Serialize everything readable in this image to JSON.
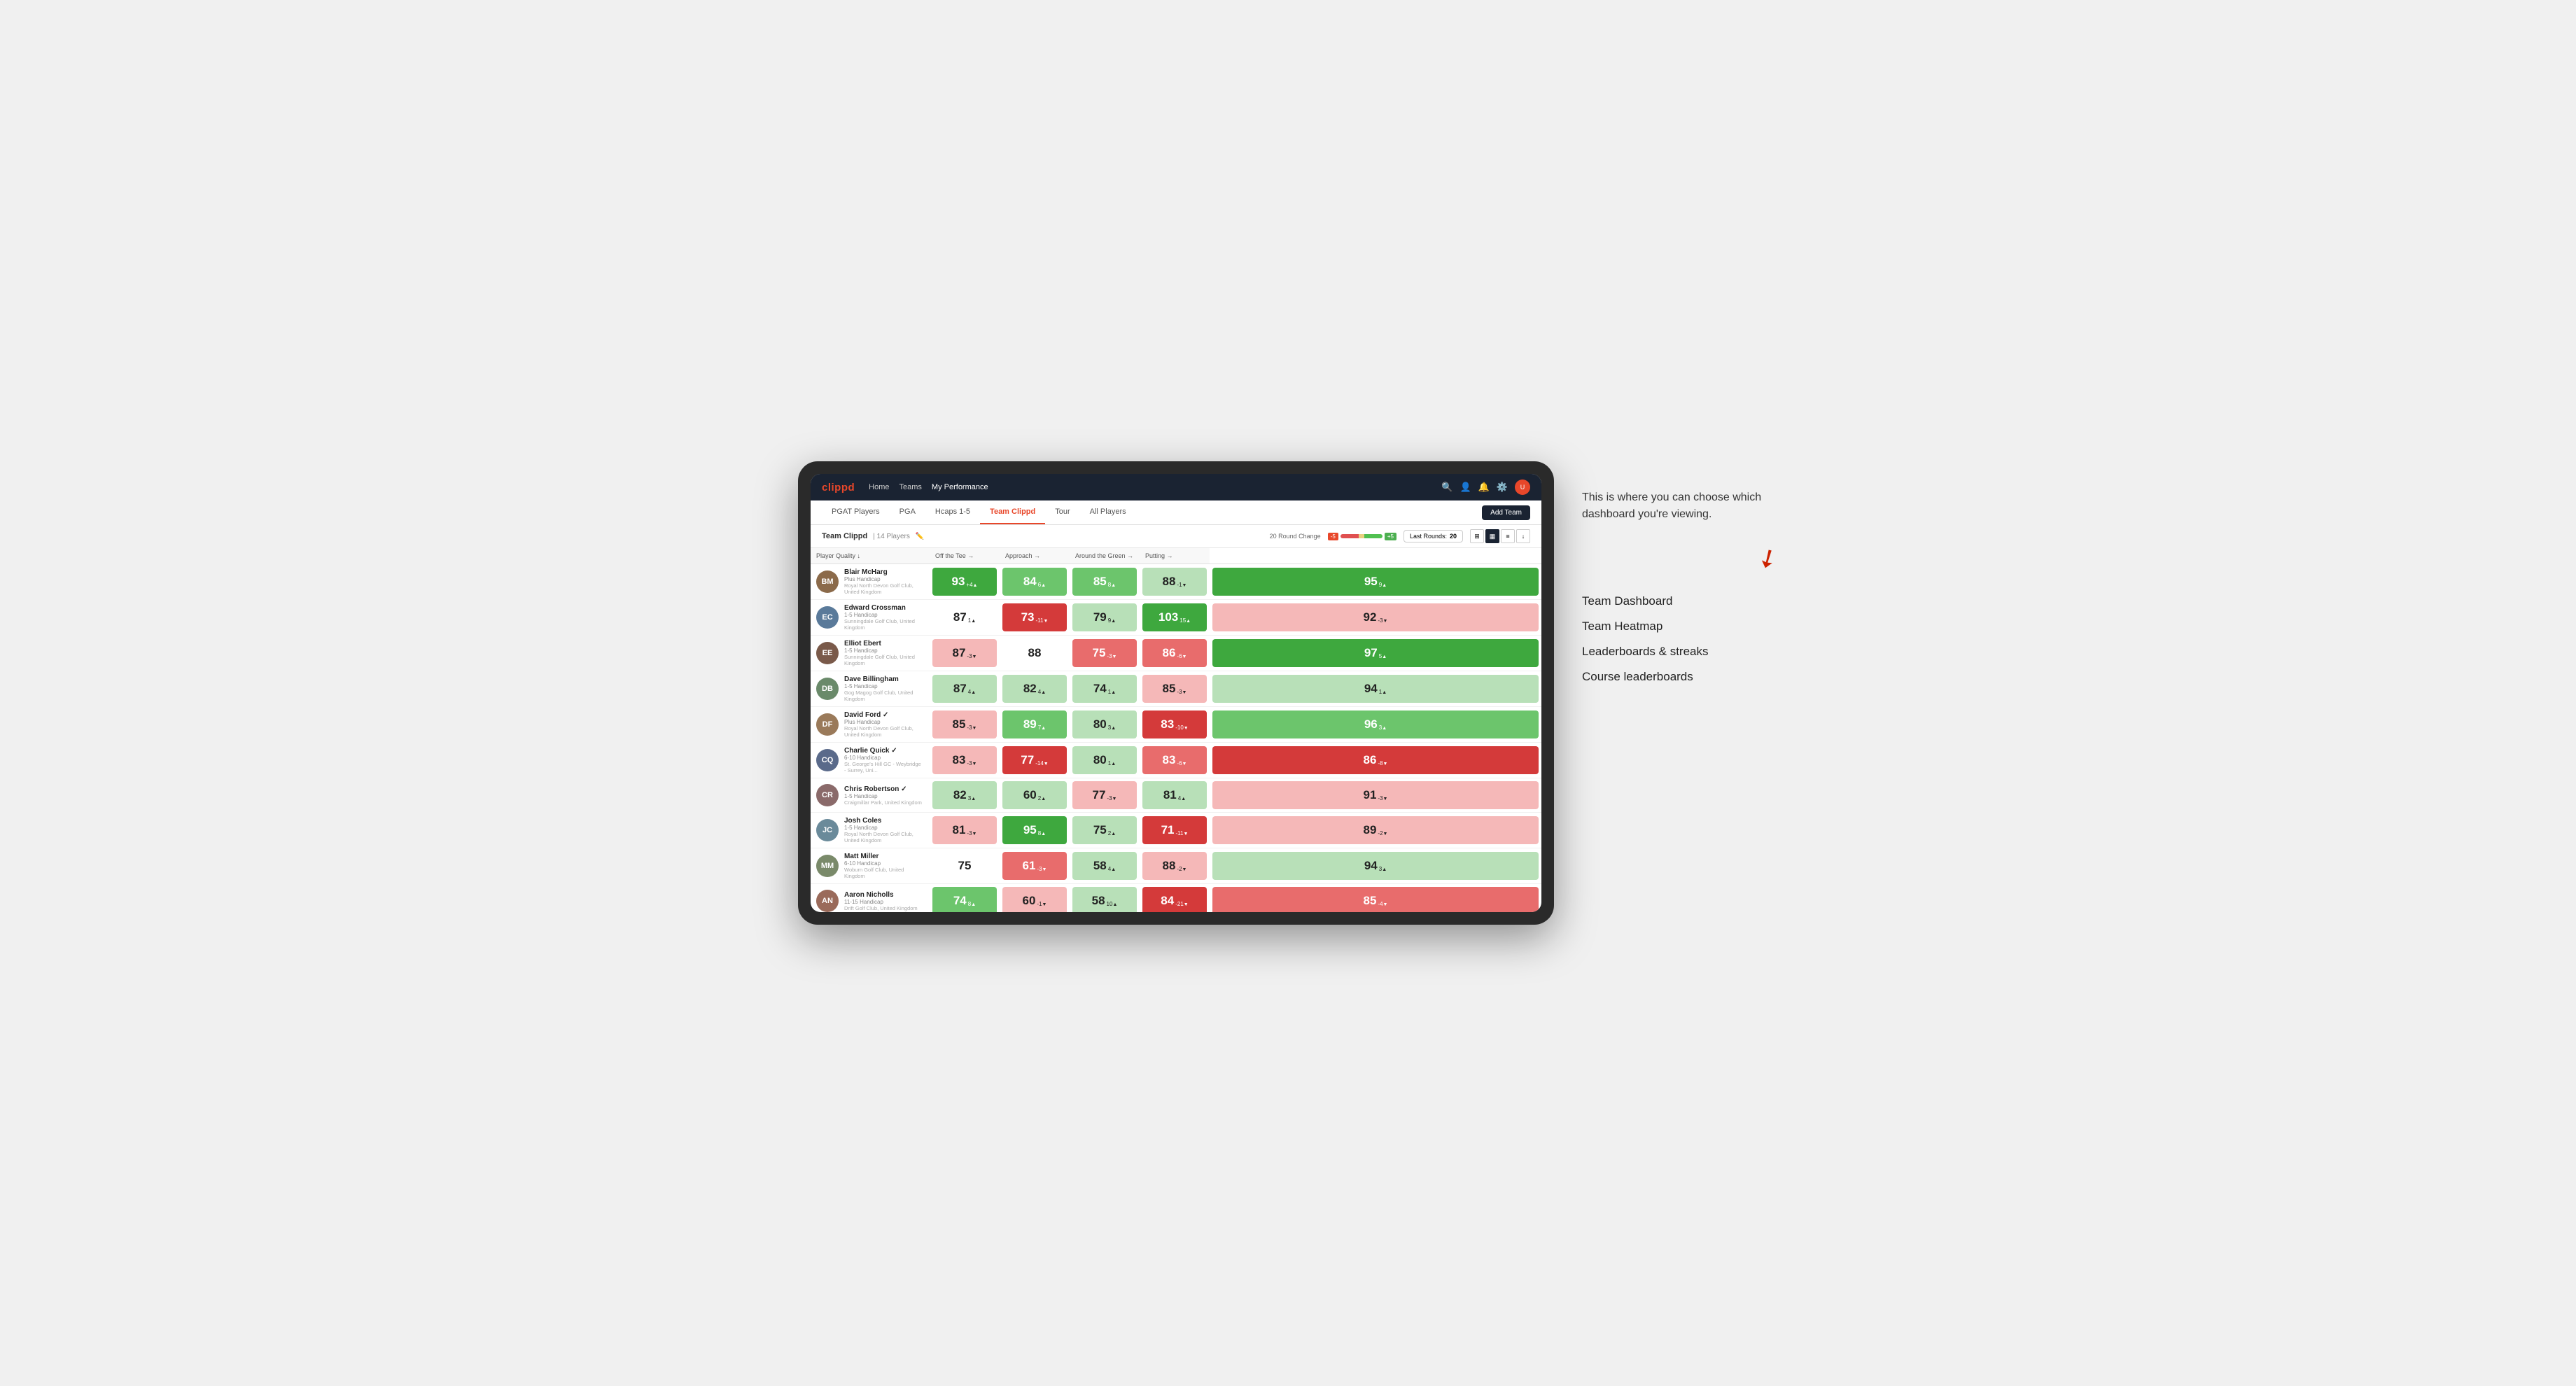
{
  "nav": {
    "logo": "clippd",
    "links": [
      "Home",
      "Teams",
      "My Performance"
    ],
    "active_link": "My Performance",
    "icons": [
      "search",
      "person",
      "bell",
      "settings",
      "avatar"
    ]
  },
  "tabs": {
    "items": [
      "PGAT Players",
      "PGA",
      "Hcaps 1-5",
      "Team Clippd",
      "Tour",
      "All Players"
    ],
    "active": "Team Clippd",
    "add_button": "Add Team"
  },
  "toolbar": {
    "team_name": "Team Clippd",
    "separator": "|",
    "player_count": "14 Players",
    "round_change_label": "20 Round Change",
    "neg_badge": "-5",
    "pos_badge": "+5",
    "last_rounds_label": "Last Rounds:",
    "last_rounds_value": "20"
  },
  "table": {
    "columns": [
      {
        "key": "player",
        "label": "Player Quality ↓"
      },
      {
        "key": "off_tee",
        "label": "Off the Tee →"
      },
      {
        "key": "approach",
        "label": "Approach →"
      },
      {
        "key": "around_green",
        "label": "Around the Green →"
      },
      {
        "key": "putting",
        "label": "Putting →"
      }
    ],
    "rows": [
      {
        "name": "Blair McHarg",
        "handicap": "Plus Handicap",
        "club": "Royal North Devon Golf Club, United Kingdom",
        "avatar_color": "#8B6A4A",
        "initials": "BM",
        "player_quality": {
          "value": 93,
          "delta": "+4",
          "dir": "up",
          "bg": "green-dark"
        },
        "off_tee": {
          "value": 84,
          "delta": "6",
          "dir": "up",
          "bg": "green-mid"
        },
        "approach": {
          "value": 85,
          "delta": "8",
          "dir": "up",
          "bg": "green-mid"
        },
        "around_green": {
          "value": 88,
          "delta": "-1",
          "dir": "down",
          "bg": "green-light"
        },
        "putting": {
          "value": 95,
          "delta": "9",
          "dir": "up",
          "bg": "green-dark"
        }
      },
      {
        "name": "Edward Crossman",
        "handicap": "1-5 Handicap",
        "club": "Sunningdale Golf Club, United Kingdom",
        "avatar_color": "#5A7A9A",
        "initials": "EC",
        "player_quality": {
          "value": 87,
          "delta": "1",
          "dir": "up",
          "bg": "white"
        },
        "off_tee": {
          "value": 73,
          "delta": "-11",
          "dir": "down",
          "bg": "red-dark"
        },
        "approach": {
          "value": 79,
          "delta": "9",
          "dir": "up",
          "bg": "green-light"
        },
        "around_green": {
          "value": 103,
          "delta": "15",
          "dir": "up",
          "bg": "green-dark"
        },
        "putting": {
          "value": 92,
          "delta": "-3",
          "dir": "down",
          "bg": "red-light"
        }
      },
      {
        "name": "Elliot Ebert",
        "handicap": "1-5 Handicap",
        "club": "Sunningdale Golf Club, United Kingdom",
        "avatar_color": "#7A5A4A",
        "initials": "EE",
        "player_quality": {
          "value": 87,
          "delta": "-3",
          "dir": "down",
          "bg": "red-light"
        },
        "off_tee": {
          "value": 88,
          "delta": "",
          "dir": "",
          "bg": "white"
        },
        "approach": {
          "value": 75,
          "delta": "-3",
          "dir": "down",
          "bg": "red-mid"
        },
        "around_green": {
          "value": 86,
          "delta": "-6",
          "dir": "down",
          "bg": "red-mid"
        },
        "putting": {
          "value": 97,
          "delta": "5",
          "dir": "up",
          "bg": "green-dark"
        }
      },
      {
        "name": "Dave Billingham",
        "handicap": "1-5 Handicap",
        "club": "Gog Magog Golf Club, United Kingdom",
        "avatar_color": "#6A8A6A",
        "initials": "DB",
        "player_quality": {
          "value": 87,
          "delta": "4",
          "dir": "up",
          "bg": "green-light"
        },
        "off_tee": {
          "value": 82,
          "delta": "4",
          "dir": "up",
          "bg": "green-light"
        },
        "approach": {
          "value": 74,
          "delta": "1",
          "dir": "up",
          "bg": "green-light"
        },
        "around_green": {
          "value": 85,
          "delta": "-3",
          "dir": "down",
          "bg": "red-light"
        },
        "putting": {
          "value": 94,
          "delta": "1",
          "dir": "up",
          "bg": "green-light"
        }
      },
      {
        "name": "David Ford",
        "handicap": "Plus Handicap",
        "club": "Royal North Devon Golf Club, United Kingdom",
        "avatar_color": "#9A7A5A",
        "initials": "DF",
        "verified": true,
        "player_quality": {
          "value": 85,
          "delta": "-3",
          "dir": "down",
          "bg": "red-light"
        },
        "off_tee": {
          "value": 89,
          "delta": "7",
          "dir": "up",
          "bg": "green-mid"
        },
        "approach": {
          "value": 80,
          "delta": "3",
          "dir": "up",
          "bg": "green-light"
        },
        "around_green": {
          "value": 83,
          "delta": "-10",
          "dir": "down",
          "bg": "red-dark"
        },
        "putting": {
          "value": 96,
          "delta": "3",
          "dir": "up",
          "bg": "green-mid"
        }
      },
      {
        "name": "Charlie Quick",
        "handicap": "6-10 Handicap",
        "club": "St. George's Hill GC - Weybridge - Surrey, Uni...",
        "avatar_color": "#5A6A8A",
        "initials": "CQ",
        "verified": true,
        "player_quality": {
          "value": 83,
          "delta": "-3",
          "dir": "down",
          "bg": "red-light"
        },
        "off_tee": {
          "value": 77,
          "delta": "-14",
          "dir": "down",
          "bg": "red-dark"
        },
        "approach": {
          "value": 80,
          "delta": "1",
          "dir": "up",
          "bg": "green-light"
        },
        "around_green": {
          "value": 83,
          "delta": "-6",
          "dir": "down",
          "bg": "red-mid"
        },
        "putting": {
          "value": 86,
          "delta": "-8",
          "dir": "down",
          "bg": "red-dark"
        }
      },
      {
        "name": "Chris Robertson",
        "handicap": "1-5 Handicap",
        "club": "Craigmillar Park, United Kingdom",
        "avatar_color": "#8A6A6A",
        "initials": "CR",
        "verified": true,
        "player_quality": {
          "value": 82,
          "delta": "3",
          "dir": "up",
          "bg": "green-light"
        },
        "off_tee": {
          "value": 60,
          "delta": "2",
          "dir": "up",
          "bg": "green-light"
        },
        "approach": {
          "value": 77,
          "delta": "-3",
          "dir": "down",
          "bg": "red-light"
        },
        "around_green": {
          "value": 81,
          "delta": "4",
          "dir": "up",
          "bg": "green-light"
        },
        "putting": {
          "value": 91,
          "delta": "-3",
          "dir": "down",
          "bg": "red-light"
        }
      },
      {
        "name": "Josh Coles",
        "handicap": "1-5 Handicap",
        "club": "Royal North Devon Golf Club, United Kingdom",
        "avatar_color": "#6A8A9A",
        "initials": "JC",
        "player_quality": {
          "value": 81,
          "delta": "-3",
          "dir": "down",
          "bg": "red-light"
        },
        "off_tee": {
          "value": 95,
          "delta": "8",
          "dir": "up",
          "bg": "green-dark"
        },
        "approach": {
          "value": 75,
          "delta": "2",
          "dir": "up",
          "bg": "green-light"
        },
        "around_green": {
          "value": 71,
          "delta": "-11",
          "dir": "down",
          "bg": "red-dark"
        },
        "putting": {
          "value": 89,
          "delta": "-2",
          "dir": "down",
          "bg": "red-light"
        }
      },
      {
        "name": "Matt Miller",
        "handicap": "6-10 Handicap",
        "club": "Woburn Golf Club, United Kingdom",
        "avatar_color": "#7A8A6A",
        "initials": "MM",
        "player_quality": {
          "value": 75,
          "delta": "",
          "dir": "",
          "bg": "white"
        },
        "off_tee": {
          "value": 61,
          "delta": "-3",
          "dir": "down",
          "bg": "red-mid"
        },
        "approach": {
          "value": 58,
          "delta": "4",
          "dir": "up",
          "bg": "green-light"
        },
        "around_green": {
          "value": 88,
          "delta": "-2",
          "dir": "down",
          "bg": "red-light"
        },
        "putting": {
          "value": 94,
          "delta": "3",
          "dir": "up",
          "bg": "green-light"
        }
      },
      {
        "name": "Aaron Nicholls",
        "handicap": "11-15 Handicap",
        "club": "Drift Golf Club, United Kingdom",
        "avatar_color": "#9A6A5A",
        "initials": "AN",
        "player_quality": {
          "value": 74,
          "delta": "8",
          "dir": "up",
          "bg": "green-mid"
        },
        "off_tee": {
          "value": 60,
          "delta": "-1",
          "dir": "down",
          "bg": "red-light"
        },
        "approach": {
          "value": 58,
          "delta": "10",
          "dir": "up",
          "bg": "green-light"
        },
        "around_green": {
          "value": 84,
          "delta": "-21",
          "dir": "down",
          "bg": "red-dark"
        },
        "putting": {
          "value": 85,
          "delta": "-4",
          "dir": "down",
          "bg": "red-mid"
        }
      }
    ]
  },
  "annotation": {
    "intro_text": "This is where you can choose which dashboard you're viewing.",
    "items": [
      "Team Dashboard",
      "Team Heatmap",
      "Leaderboards & streaks",
      "Course leaderboards"
    ]
  }
}
